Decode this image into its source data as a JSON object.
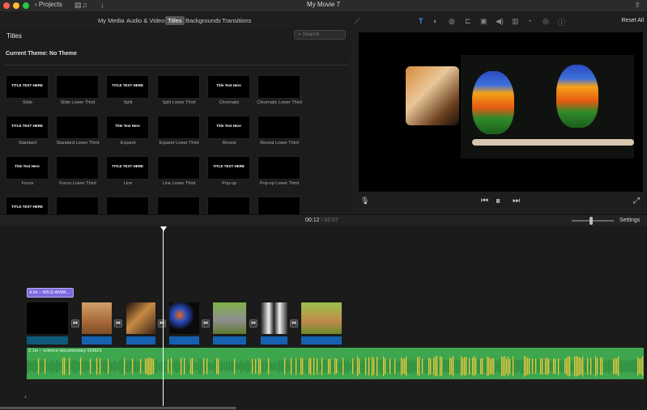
{
  "window": {
    "title": "My Movie 7",
    "projects_label": "Projects"
  },
  "tabs": [
    "My Media",
    "Audio & Video",
    "Titles",
    "Backgrounds",
    "Transitions"
  ],
  "browser": {
    "heading": "Titles",
    "search_placeholder": "Search",
    "theme_label": "Current Theme: No Theme",
    "tiles": [
      {
        "thumb": "TITLE TEXT HERE",
        "label": "Slide"
      },
      {
        "thumb": "",
        "label": "Slide Lower Third"
      },
      {
        "thumb": "TITLE TEXT HERE",
        "label": "Split"
      },
      {
        "thumb": "",
        "label": "Split Lower Third"
      },
      {
        "thumb": "Title Text Here",
        "label": "Chromatic"
      },
      {
        "thumb": "",
        "label": "Chromatic Lower Third"
      },
      {
        "thumb": "TITLE TEXT HERE",
        "label": "Standard"
      },
      {
        "thumb": "",
        "label": "Standard Lower Third"
      },
      {
        "thumb": "Title Text Here",
        "label": "Expand"
      },
      {
        "thumb": "",
        "label": "Expand Lower Third"
      },
      {
        "thumb": "Title Text Here",
        "label": "Reveal"
      },
      {
        "thumb": "",
        "label": "Reveal Lower Third"
      },
      {
        "thumb": "Title Text Here",
        "label": "Focus"
      },
      {
        "thumb": "",
        "label": "Focus Lower Third"
      },
      {
        "thumb": "TITLE TEXT HERE",
        "label": "Line"
      },
      {
        "thumb": "",
        "label": "Line Lower Third"
      },
      {
        "thumb": "TITLE TEXT HERE",
        "label": "Pop-up"
      },
      {
        "thumb": "",
        "label": "Pop-up Lower Third"
      },
      {
        "thumb": "TITLE TEXT HERE",
        "label": ""
      },
      {
        "thumb": "",
        "label": ""
      },
      {
        "thumb": "",
        "label": ""
      },
      {
        "thumb": "",
        "label": ""
      },
      {
        "thumb": "",
        "label": ""
      },
      {
        "thumb": "",
        "label": ""
      }
    ]
  },
  "viewer": {
    "reset_label": "Reset All",
    "tools": [
      "wand-icon",
      "text-icon",
      "color-balance-icon",
      "color-correction-icon",
      "crop-icon",
      "stabilization-icon",
      "volume-icon",
      "noise-reduction-icon",
      "speed-icon",
      "filter-icon",
      "info-icon"
    ]
  },
  "timeline": {
    "current_time": "00:12",
    "separator": " / ",
    "duration": "02:07",
    "settings_label": "Settings",
    "title_clip_label": "4.0s – WILD ANIM...",
    "audio_label": "2.1m – science-documentary-169621",
    "transition_icon": "⧓"
  },
  "colors": {
    "accent": "#3b8ef0",
    "title_clip": "#7d6ae0",
    "audio_track": "#3da64e",
    "clip_bar": "#1561b0"
  }
}
